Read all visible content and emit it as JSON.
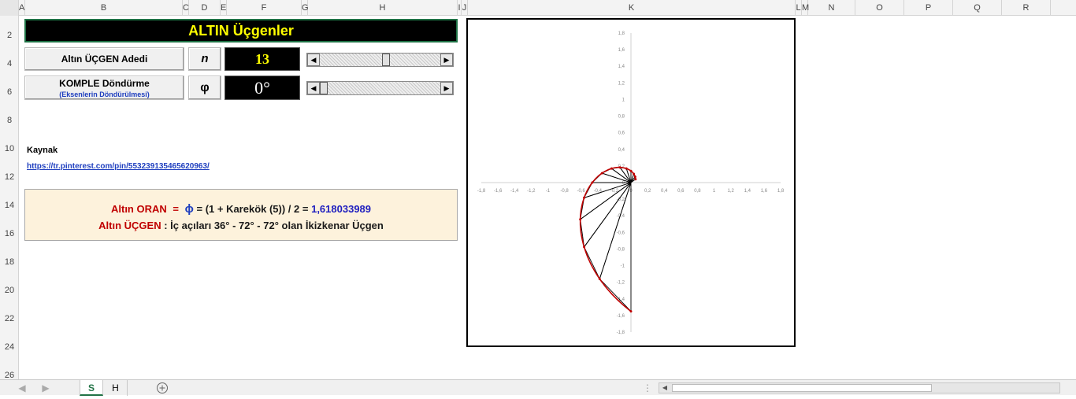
{
  "columns": [
    {
      "label": "A"
    },
    {
      "label": "B"
    },
    {
      "label": "C"
    },
    {
      "label": "D"
    },
    {
      "label": "E"
    },
    {
      "label": "F"
    },
    {
      "label": "G"
    },
    {
      "label": "H"
    },
    {
      "label": "I"
    },
    {
      "label": "J"
    },
    {
      "label": "K"
    },
    {
      "label": "L"
    },
    {
      "label": "M"
    },
    {
      "label": "N"
    },
    {
      "label": "O"
    },
    {
      "label": "P"
    },
    {
      "label": "Q"
    },
    {
      "label": "R"
    }
  ],
  "rows": [
    "2",
    "4",
    "6",
    "8",
    "10",
    "12",
    "14",
    "16",
    "18",
    "20",
    "22",
    "24",
    "26"
  ],
  "title": "ALTIN Üçgenler",
  "controls": {
    "count_label": "Altın ÜÇGEN  Adedi",
    "count_symbol": "n",
    "count_value": "13",
    "count_slider_fraction": 0.55,
    "rotate_label": "KOMPLE Döndürme",
    "rotate_sublabel": "(Eksenlerin Döndürülmesi)",
    "rotate_symbol": "φ",
    "rotate_value": "0°",
    "rotate_slider_fraction": 0.0
  },
  "source": {
    "label": "Kaynak",
    "link": "https://tr.pinterest.com/pin/553239135465620963/"
  },
  "info": {
    "line1_label": "Altın ORAN",
    "line1_eq": "=",
    "line1_phi": "ϕ",
    "line1_formula": "= (1 + Karekök (5)) / 2 =",
    "line1_value": "1,618033989",
    "line2_label": "Altın ÜÇGEN",
    "line2_text": ": İç açıları  36° - 72° - 72°  olan İkizkenar Üçgen"
  },
  "chart_data": {
    "type": "scatter",
    "xlim": [
      -1.8,
      1.8
    ],
    "ylim": [
      -1.8,
      1.8
    ],
    "x_ticks": [
      "-1,8",
      "-1,6",
      "-1,4",
      "-1,2",
      "-1",
      "-0,8",
      "-0,6",
      "-0,4",
      "-0,2",
      "0",
      "0,2",
      "0,4",
      "0,6",
      "0,8",
      "1",
      "1,2",
      "1,4",
      "1,6",
      "1,8"
    ],
    "y_ticks": [
      "1,8",
      "1,6",
      "1,4",
      "1,2",
      "1",
      "0,8",
      "0,6",
      "0,4",
      "0,2",
      "0",
      "-0,2",
      "-0,4",
      "-0,6",
      "-0,8",
      "-1",
      "-1,2",
      "-1,4",
      "-1,6",
      "-1,8"
    ],
    "grid": false,
    "triangles": 13,
    "spiral_color": "#c00000",
    "triangle_color": "#000000"
  },
  "sheets": [
    {
      "label": "S",
      "active": true
    },
    {
      "label": "H",
      "active": false
    }
  ],
  "add_sheet_icon": "plus-circle-icon"
}
